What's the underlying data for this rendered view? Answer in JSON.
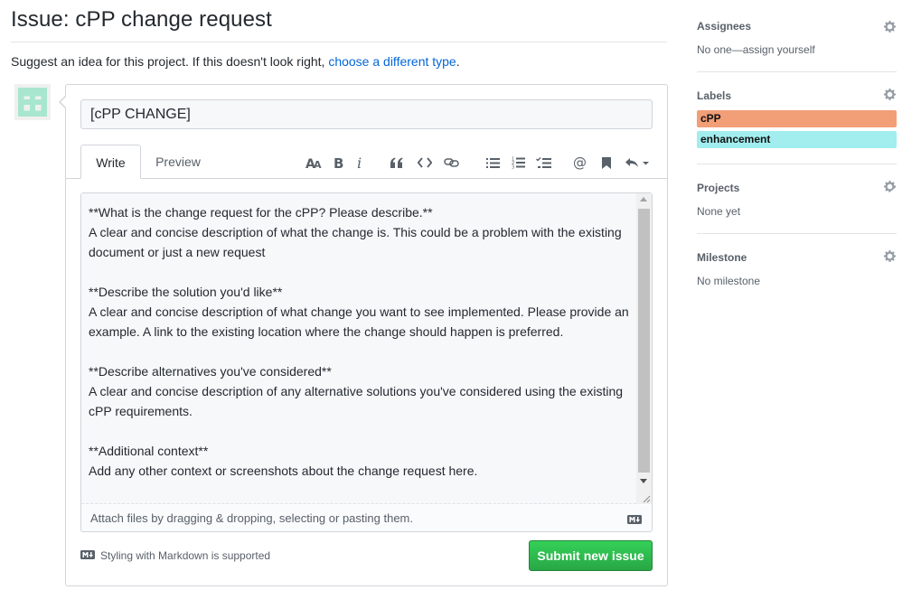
{
  "header": {
    "title": "Issue: cPP change request",
    "suggest_prefix": "Suggest an idea for this project. If this doesn't look right,",
    "suggest_link": "choose a different type",
    "suggest_suffix": "."
  },
  "form": {
    "title_value": "[cPP CHANGE]",
    "tabs": [
      {
        "label": "Write",
        "active": true
      },
      {
        "label": "Preview",
        "active": false
      }
    ],
    "toolbar_icons": [
      "text-size-icon",
      "bold-icon",
      "italic-icon",
      "quote-icon",
      "code-icon",
      "link-icon",
      "unordered-list-icon",
      "ordered-list-icon",
      "task-list-icon",
      "mention-icon",
      "bookmark-icon",
      "reply-icon"
    ],
    "body": "**What is the change request for the cPP? Please describe.**\nA clear and concise description of what the change is. This could be a problem with the existing document or just a new request\n\n**Describe the solution you'd like**\nA clear and concise description of what change you want to see implemented. Please provide an example. A link to the existing location where the change should happen is preferred.\n\n**Describe alternatives you've considered**\nA clear and concise description of any alternative solutions you've considered using the existing cPP requirements.\n\n**Additional context**\nAdd any other context or screenshots about the change request here.",
    "attach_hint": "Attach files by dragging & dropping, selecting or pasting them.",
    "markdown_note": "Styling with Markdown is supported",
    "submit_label": "Submit new issue"
  },
  "sidebar": {
    "assignees": {
      "heading": "Assignees",
      "value": "No one—assign yourself"
    },
    "labels": {
      "heading": "Labels",
      "items": [
        {
          "name": "cPP",
          "color": "#f29e77"
        },
        {
          "name": "enhancement",
          "color": "#a2eeef"
        }
      ]
    },
    "projects": {
      "heading": "Projects",
      "value": "None yet"
    },
    "milestone": {
      "heading": "Milestone",
      "value": "No milestone"
    }
  },
  "colors": {
    "link": "#0366d6",
    "submit": "#28a745",
    "avatar": "#a8e6cf"
  }
}
